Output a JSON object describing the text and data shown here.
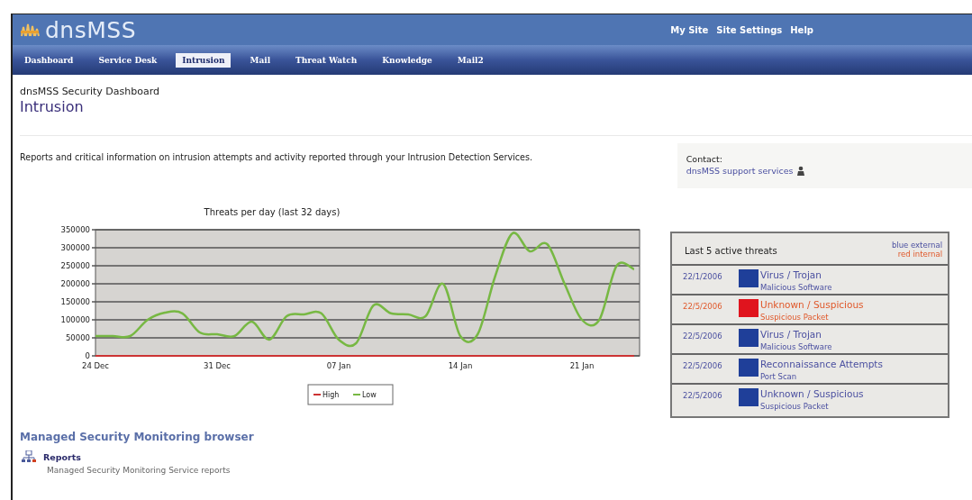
{
  "header": {
    "logo": "dnsMSS",
    "links": [
      "My Site",
      "Site Settings",
      "Help"
    ]
  },
  "tabs": [
    {
      "label": "Dashboard",
      "selected": false
    },
    {
      "label": "Service Desk",
      "selected": false
    },
    {
      "label": "Intrusion",
      "selected": true
    },
    {
      "label": "Mail",
      "selected": false
    },
    {
      "label": "Threat Watch",
      "selected": false
    },
    {
      "label": "Knowledge",
      "selected": false
    },
    {
      "label": "Mail2",
      "selected": false
    }
  ],
  "page": {
    "breadcrumb": "dnsMSS Security Dashboard",
    "title": "Intrusion",
    "description": "Reports and critical information on intrusion attempts and activity reported through your Intrusion Detection Services."
  },
  "contact": {
    "label": "Contact:",
    "link": "dnsMSS support services"
  },
  "chart": {
    "chart_data": {
      "type": "line",
      "title": "Threats per day (last 32 days)",
      "categories": [
        "24 Dec",
        null,
        null,
        null,
        null,
        null,
        null,
        "31 Dec",
        null,
        null,
        null,
        null,
        null,
        null,
        "07 Jan",
        null,
        null,
        null,
        null,
        null,
        null,
        "14 Jan",
        null,
        null,
        null,
        null,
        null,
        null,
        "21 Jan",
        null,
        null,
        null
      ],
      "grid": true,
      "legend": true,
      "series": [
        {
          "name": "High",
          "color": "#cc3333",
          "values": [
            0,
            0,
            0,
            0,
            0,
            0,
            0,
            0,
            0,
            0,
            0,
            0,
            0,
            0,
            0,
            0,
            0,
            0,
            0,
            0,
            0,
            0,
            0,
            0,
            0,
            0,
            0,
            0,
            0,
            0,
            0,
            0
          ]
        },
        {
          "name": "Low",
          "color": "#77b843",
          "values": [
            55000,
            55000,
            55000,
            100000,
            120000,
            118000,
            65000,
            60000,
            55000,
            95000,
            45000,
            110000,
            115000,
            118000,
            45000,
            35000,
            140000,
            118000,
            115000,
            110000,
            200000,
            55000,
            60000,
            220000,
            340000,
            290000,
            310000,
            200000,
            100000,
            100000,
            250000,
            240000
          ]
        }
      ],
      "ylim": [
        0,
        350000
      ],
      "yticks": [
        0,
        50000,
        100000,
        150000,
        200000,
        250000,
        300000,
        350000
      ]
    }
  },
  "threats": {
    "title": "Last 5 active threats",
    "legend": [
      {
        "label": "blue external",
        "kind": "external"
      },
      {
        "label": "red internal",
        "kind": "internal"
      }
    ],
    "items": [
      {
        "date": "22/1/2006",
        "kind": "external",
        "color": "#1f3f99",
        "name": "Virus / Trojan",
        "detail": "Malicious Software"
      },
      {
        "date": "22/5/2006",
        "kind": "internal",
        "color": "#e0141e",
        "name": "Unknown / Suspicious",
        "detail": "Suspicious Packet"
      },
      {
        "date": "22/5/2006",
        "kind": "external",
        "color": "#1f3f99",
        "name": "Virus / Trojan",
        "detail": "Malicious Software"
      },
      {
        "date": "22/5/2006",
        "kind": "external",
        "color": "#1f3f99",
        "name": "Reconnaissance Attempts",
        "detail": "Port Scan"
      },
      {
        "date": "22/5/2006",
        "kind": "external",
        "color": "#1f3f99",
        "name": "Unknown / Suspicious",
        "detail": "Suspicious Packet"
      }
    ]
  },
  "browser": {
    "title": "Managed Security Monitoring browser",
    "items": [
      {
        "label": "Reports",
        "description": "Managed Security Monitoring Service reports"
      }
    ]
  }
}
